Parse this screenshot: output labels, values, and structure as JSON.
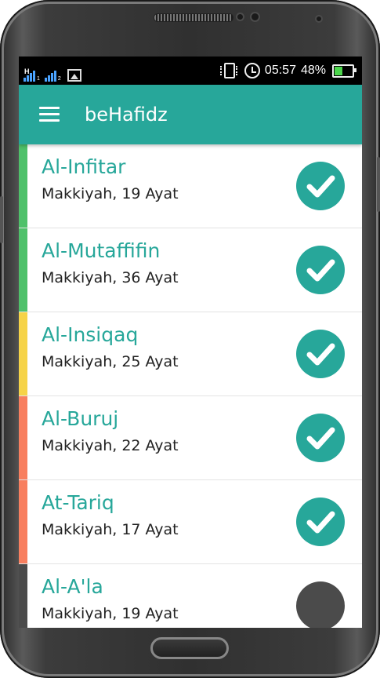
{
  "status_bar": {
    "time": "05:57",
    "battery": "48%",
    "battery_level": 0.48,
    "sim1_network": "H",
    "sim1_index": "1",
    "sim2_index": "2",
    "icons": [
      "signal-icon",
      "signal-icon",
      "image-icon",
      "vibrate-icon",
      "alarm-icon",
      "battery-icon"
    ]
  },
  "app_bar": {
    "title": "beHafidz",
    "menu_icon": "hamburger-menu-icon"
  },
  "colors": {
    "accent": "#27a79a",
    "unchecked": "#4b4b4b"
  },
  "surahs": [
    {
      "name": "Al-Infitar",
      "info": "Makkiyah, 19 Ayat",
      "stripe": "#4fc16a",
      "checked": true
    },
    {
      "name": "Al-Mutaffifin",
      "info": "Makkiyah, 36 Ayat",
      "stripe": "#4fc16a",
      "checked": true
    },
    {
      "name": "Al-Insiqaq",
      "info": "Makkiyah, 25 Ayat",
      "stripe": "#f6d348",
      "checked": true
    },
    {
      "name": "Al-Buruj",
      "info": "Makkiyah, 22 Ayat",
      "stripe": "#f87f5f",
      "checked": true
    },
    {
      "name": "At-Tariq",
      "info": "Makkiyah, 17 Ayat",
      "stripe": "#f87f5f",
      "checked": true
    },
    {
      "name": "Al-A'la",
      "info": "Makkiyah, 19 Ayat",
      "stripe": "#4b4b4b",
      "checked": false
    }
  ]
}
